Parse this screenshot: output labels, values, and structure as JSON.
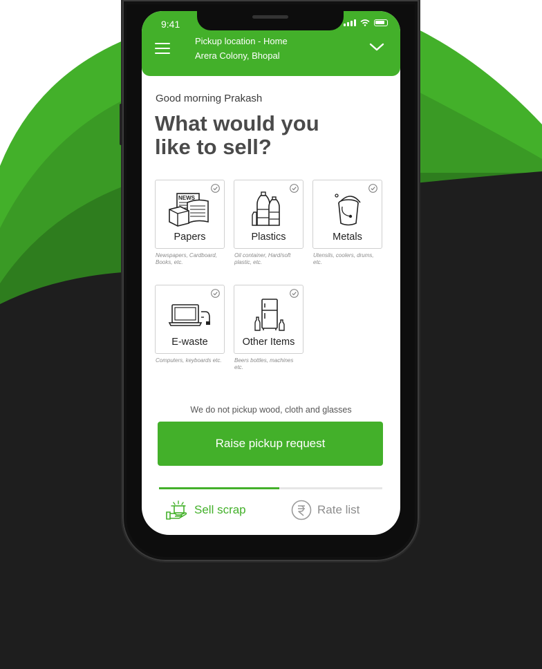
{
  "colors": {
    "brand_green": "#43b02a",
    "dark_bg": "#1e1e1e",
    "screen_bg": "#ffffff"
  },
  "status_bar": {
    "time": "9:41",
    "icons": [
      "signal-icon",
      "wifi-icon",
      "battery-icon"
    ]
  },
  "header": {
    "menu_icon": "hamburger-menu-icon",
    "location_title": "Pickup location - Home",
    "location_address": "Arera Colony, Bhopal",
    "dropdown_icon": "chevron-down-icon"
  },
  "main": {
    "greeting": "Good morning Prakash",
    "headline": "What would you like to sell?",
    "categories": [
      {
        "label": "Papers",
        "description": "Newspapers, Cardboard, Books, etc.",
        "icon": "newspaper-icon",
        "selected": false
      },
      {
        "label": "Plastics",
        "description": "Oil container, Hard/soft plastic, etc.",
        "icon": "plastic-bottles-icon",
        "selected": false
      },
      {
        "label": "Metals",
        "description": "Utensils, coolers, drums, etc.",
        "icon": "metal-bucket-icon",
        "selected": false
      },
      {
        "label": "E-waste",
        "description": "Computers, keyboards etc.",
        "icon": "laptop-icon",
        "selected": false
      },
      {
        "label": "Other Items",
        "description": "Beers bottles, machines etc.",
        "icon": "fridge-icon",
        "selected": false
      }
    ],
    "notice": "We do not pickup wood, cloth and glasses",
    "cta_label": "Raise pickup request"
  },
  "bottom_nav": {
    "active_tab_fraction": 0.54,
    "tabs": [
      {
        "label": "Sell scrap",
        "icon": "sell-scrap-icon",
        "active": true
      },
      {
        "label": "Rate list",
        "icon": "rupee-icon",
        "active": false
      }
    ]
  }
}
